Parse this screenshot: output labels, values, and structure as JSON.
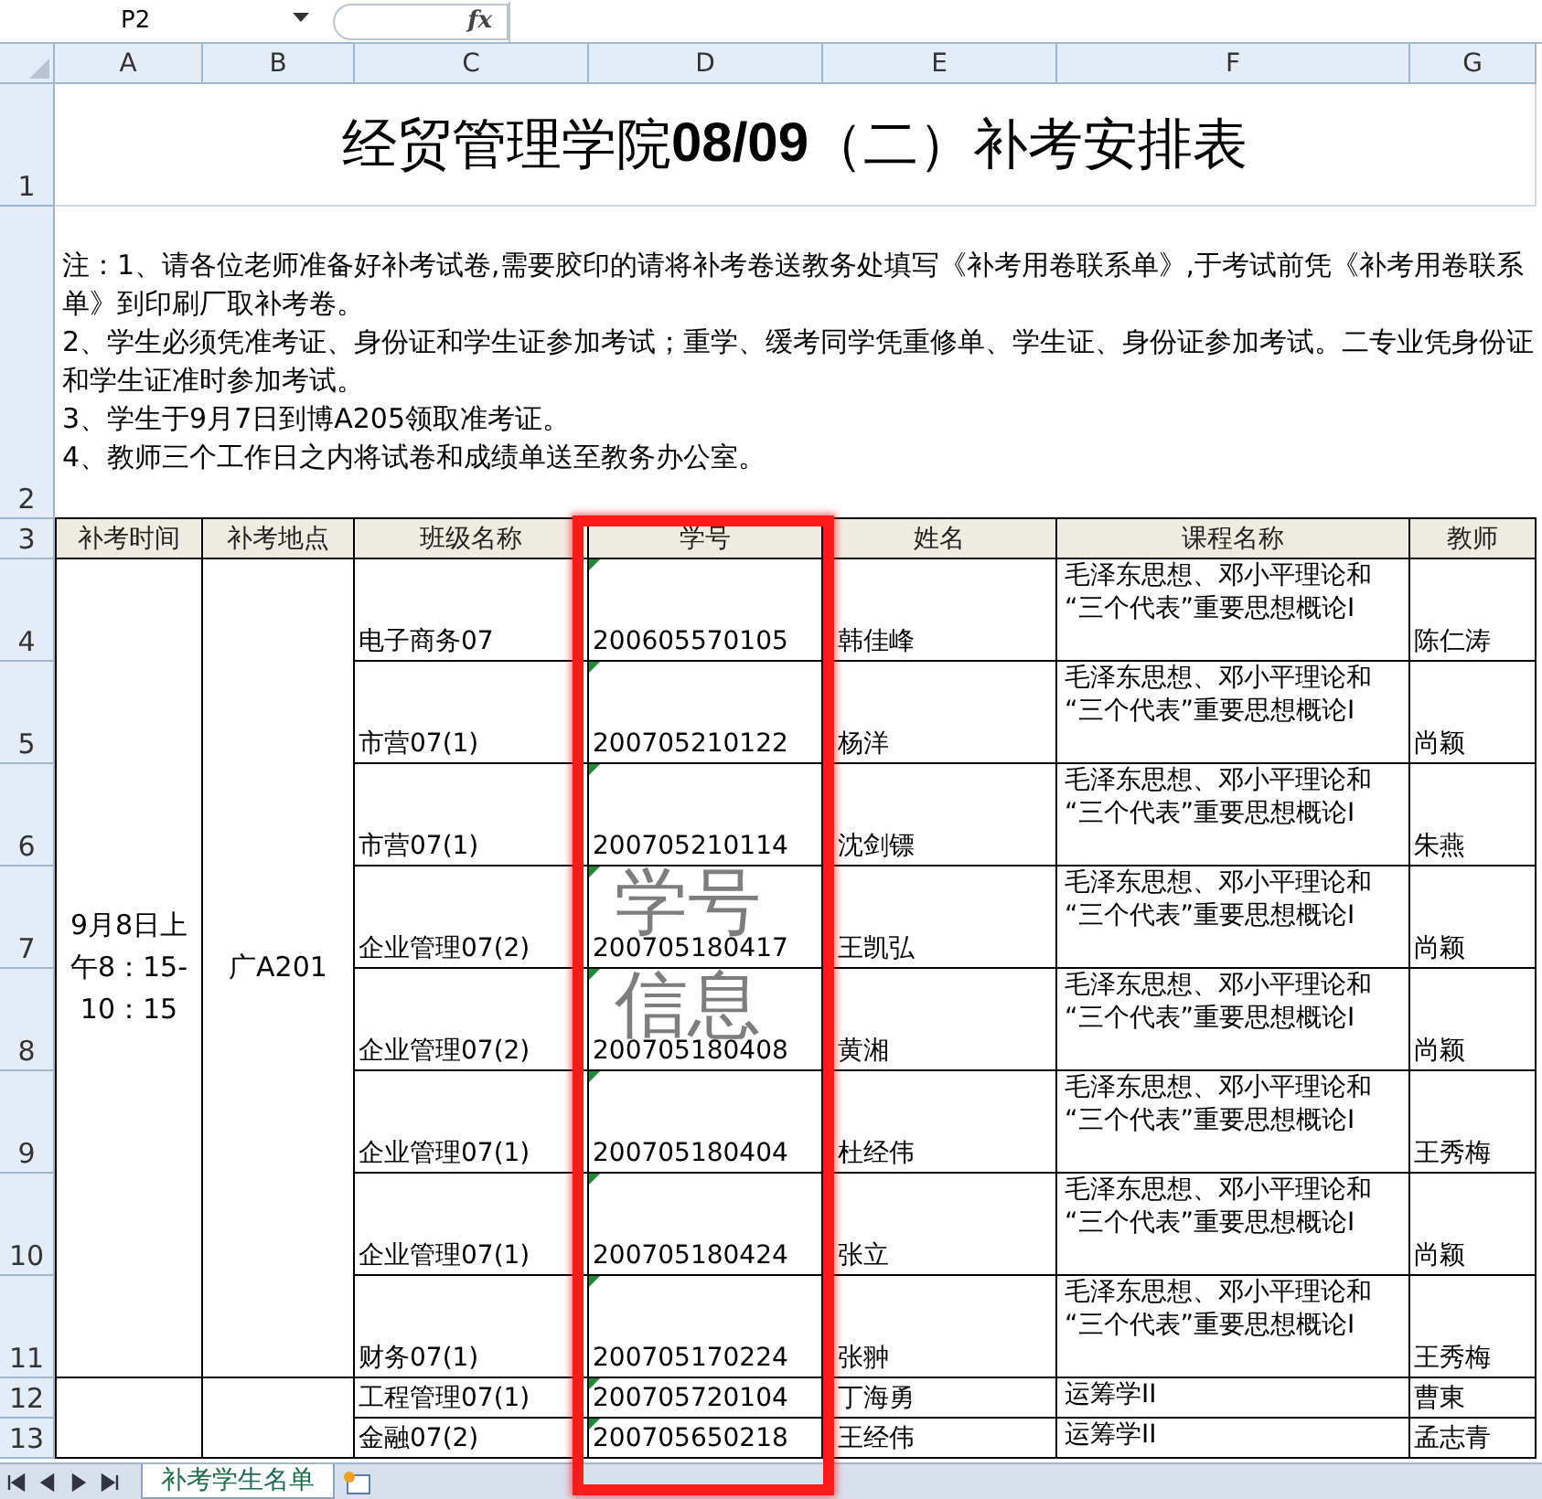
{
  "formula_bar": {
    "name_box": "P2",
    "fx": "fx"
  },
  "columns": [
    "A",
    "B",
    "C",
    "D",
    "E",
    "F",
    "G"
  ],
  "title": {
    "row": "1",
    "text": "经贸管理学院**08/09**（二）补考安排表"
  },
  "notes": {
    "row": "2",
    "lines": [
      "注：1、请各位老师准备好补考试卷,需要胶印的请将补考卷送教务处填写《补考用卷联系单》,于考试前凭《补考用卷联系单》到印刷厂取补考卷。",
      "2、学生必须凭准考证、身份证和学生证参加考试；重学、缓考同学凭重修单、学生证、身份证参加考试。二专业凭身份证和学生证准时参加考试。",
      "3、学生于9月7日到博A205领取准考证。",
      "4、教师三个工作日之内将试卷和成绩单送至教务办公室。"
    ]
  },
  "header": {
    "row": "3",
    "labels": [
      "补考时间",
      "补考地点",
      "班级名称",
      "学号",
      "姓名",
      "课程名称",
      "教师"
    ]
  },
  "groups": [
    {
      "time": "9月8日上午8：15-10：15",
      "room": "广A201",
      "rows": [
        {
          "row": "4",
          "class": "电子商务07",
          "id": "200605570105",
          "flagged": true,
          "name": "韩佳峰",
          "course": "毛泽东思想、邓小平理论和“三个代表”重要思想概论Ⅰ",
          "teacher": "陈仁涛"
        },
        {
          "row": "5",
          "class": "市营07(1)",
          "id": "200705210122",
          "flagged": true,
          "name": "杨洋",
          "course": "毛泽东思想、邓小平理论和“三个代表”重要思想概论Ⅰ",
          "teacher": "尚颖"
        },
        {
          "row": "6",
          "class": "市营07(1)",
          "id": "200705210114",
          "flagged": true,
          "name": "沈剑镖",
          "course": "毛泽东思想、邓小平理论和“三个代表”重要思想概论Ⅰ",
          "teacher": "朱燕"
        },
        {
          "row": "7",
          "class": "企业管理07(2)",
          "id": "200705180417",
          "flagged": true,
          "name": "王凯弘",
          "course": "毛泽东思想、邓小平理论和“三个代表”重要思想概论Ⅰ",
          "teacher": "尚颖"
        },
        {
          "row": "8",
          "class": "企业管理07(2)",
          "id": "200705180408",
          "flagged": true,
          "name": "黄湘",
          "course": "毛泽东思想、邓小平理论和“三个代表”重要思想概论Ⅰ",
          "teacher": "尚颖"
        },
        {
          "row": "9",
          "class": "企业管理07(1)",
          "id": "200705180404",
          "flagged": true,
          "name": "杜经伟",
          "course": "毛泽东思想、邓小平理论和“三个代表”重要思想概论Ⅰ",
          "teacher": "王秀梅"
        },
        {
          "row": "10",
          "class": "企业管理07(1)",
          "id": "200705180424",
          "flagged": true,
          "name": "张立",
          "course": "毛泽东思想、邓小平理论和“三个代表”重要思想概论Ⅰ",
          "teacher": "尚颖"
        },
        {
          "row": "11",
          "class": "财务07(1)",
          "id": "200705170224",
          "flagged": true,
          "name": "张翀",
          "course": "毛泽东思想、邓小平理论和“三个代表”重要思想概论Ⅰ",
          "teacher": "王秀梅"
        }
      ]
    },
    {
      "rows": [
        {
          "row": "12",
          "class": "工程管理07(1)",
          "id": "200705720104",
          "flagged": true,
          "name": "丁海勇",
          "course": "运筹学ⅠⅠ",
          "teacher": "曹東"
        },
        {
          "row": "13",
          "class": "金融07(2)",
          "id": "200705650218",
          "flagged": true,
          "name": "王经伟",
          "course": "运筹学ⅠⅠ",
          "teacher": "孟志青"
        }
      ]
    }
  ],
  "sheet_tabs": [
    {
      "label": "补考学生名单",
      "selected": true
    }
  ],
  "annotation": {
    "lines": [
      "学号",
      "信息"
    ]
  }
}
